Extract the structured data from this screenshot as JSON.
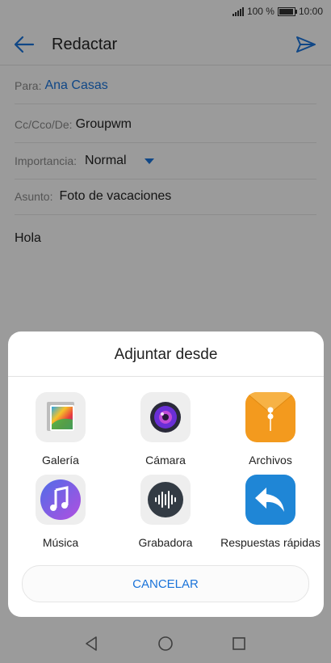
{
  "status_bar": {
    "battery": "100 %",
    "time": "10:00"
  },
  "app_bar": {
    "title": "Redactar"
  },
  "form": {
    "to_label": "Para:",
    "to_value": "Ana Casas",
    "cc_label": "Cc/Cco/De:",
    "cc_value": "Groupwm",
    "importance_label": "Importancia:",
    "importance_value": "Normal",
    "subject_label": "Asunto:",
    "subject_value": "Foto de vacaciones",
    "body": "Hola"
  },
  "sheet": {
    "title": "Adjuntar desde",
    "options": [
      {
        "label": "Galería",
        "icon": "gallery-icon"
      },
      {
        "label": "Cámara",
        "icon": "camera-icon"
      },
      {
        "label": "Archivos",
        "icon": "files-icon"
      },
      {
        "label": "Música",
        "icon": "music-icon"
      },
      {
        "label": "Grabadora",
        "icon": "recorder-icon"
      },
      {
        "label": "Respuestas rápidas",
        "icon": "quick-reply-icon"
      }
    ],
    "cancel_label": "CANCELAR"
  },
  "colors": {
    "accent": "#1a73d9"
  }
}
